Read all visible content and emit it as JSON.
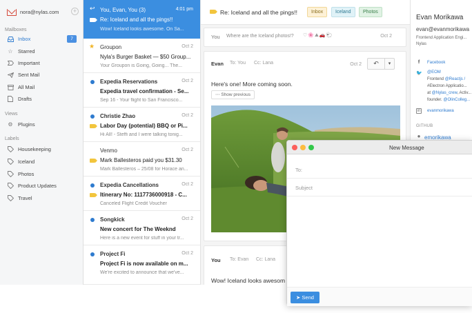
{
  "account": {
    "email": "nora@nylas.com",
    "add_icon": "plus-circle-icon"
  },
  "sidebar": {
    "mailboxes_label": "Mailboxes",
    "items": [
      {
        "label": "Inbox",
        "icon": "inbox-icon",
        "badge": "7",
        "active": true
      },
      {
        "label": "Starred",
        "icon": "star-icon"
      },
      {
        "label": "Important",
        "icon": "important-icon"
      },
      {
        "label": "Sent Mail",
        "icon": "sent-icon"
      },
      {
        "label": "All Mail",
        "icon": "archive-icon"
      },
      {
        "label": "Drafts",
        "icon": "drafts-icon"
      }
    ],
    "views_label": "Views",
    "views": [
      {
        "label": "Plugins",
        "icon": "plugins-icon"
      }
    ],
    "labels_label": "Labels",
    "labels": [
      {
        "label": "Housekeeping",
        "icon": "tag-icon"
      },
      {
        "label": "Iceland",
        "icon": "tag-icon"
      },
      {
        "label": "Photos",
        "icon": "tag-icon"
      },
      {
        "label": "Product Updates",
        "icon": "tag-icon"
      },
      {
        "label": "Travel",
        "icon": "tag-icon"
      }
    ]
  },
  "threads": [
    {
      "from": "You, Evan, You (3)",
      "date": "4:01 pm",
      "subject": "Re: Iceland and all the pings!!",
      "snippet": "Wow! Iceland looks awesome. On Sa...",
      "selected": true
    },
    {
      "from": "Groupon",
      "date": "Oct 2",
      "subject": "Nyla's Burger Basket — $50 Group...",
      "snippet": "Your Groupon is Going, Going... The..."
    },
    {
      "from": "Expedia Reservations",
      "date": "Oct 2",
      "subject": "Expedia travel confirmation - Se...",
      "snippet": "Sep 16 - Your flight to San Francisco...",
      "unread": true
    },
    {
      "from": "Christie Zhao",
      "date": "Oct 2",
      "subject": "Labor Day (potential) BBQ or Pi...",
      "snippet": "Hi All! - Steffi and I were talking tonig...",
      "unread": true
    },
    {
      "from": "Venmo",
      "date": "Oct 2",
      "subject": "Mark Ballesteros paid you $31.30",
      "snippet": "Mark Ballesteros – 25/08 for Horace an..."
    },
    {
      "from": "Expedia Cancellations",
      "date": "Oct 2",
      "subject": "Itinerary No: 1117736000918 - C...",
      "snippet": "Canceled Flight Credit Voucher",
      "unread": true
    },
    {
      "from": "Songkick",
      "date": "Oct 2",
      "subject": "New concert for The Weeknd",
      "snippet": "Here is a new event for stuff in your tr...",
      "unread": true
    },
    {
      "from": "Project Fi",
      "date": "Oct 2",
      "subject": "Project Fi is now available on m...",
      "snippet": "We're excited to announce that we've...",
      "unread": true
    }
  ],
  "message": {
    "title": "Re: Iceland and all the pings!!",
    "tags": [
      "Inbox",
      "Iceland",
      "Photos"
    ],
    "collapsed": {
      "from": "You",
      "snippet": "Where are the Iceland photos!?",
      "date": "Oct 2"
    },
    "expanded": {
      "from": "Evan",
      "to": "To: You",
      "cc": "Cc: Lana",
      "date": "Oct 2",
      "body": "Here's one! More coming soon.",
      "show_previous": "Show previous"
    },
    "reply": {
      "from": "You",
      "to": "To: Evan",
      "cc": "Cc: Lana",
      "body": "Wow! Iceland looks awesom"
    }
  },
  "contact": {
    "name": "Evan Morikawa",
    "email": "evan@evanmorikawa",
    "title": "Frontend Application Engi...",
    "company": "Nylas",
    "facebook": "Facebook",
    "twitter_handle": "@EOM",
    "twitter_bio_1a": "Frontend ",
    "twitter_bio_1b": "@Reactjs /",
    "twitter_bio_2": "#Electron Applicatio...",
    "twitter_bio_3a": "at ",
    "twitter_bio_3b": "@Nylas_crew",
    "twitter_bio_3c": ", Activ...",
    "twitter_bio_4a": "founder. ",
    "twitter_bio_4b": "@OlinColleg...",
    "linkedin": "evanmorikawa",
    "github_label": "GITHUB",
    "github_user": "emorikawa"
  },
  "compose": {
    "title": "New Message",
    "to_label": "To:",
    "subject_label": "Subject",
    "send_label": "Send"
  },
  "colors": {
    "accent": "#3b8ee0",
    "label_yellow": "#f2c53d",
    "unread_dot": "#2e7bcf"
  }
}
